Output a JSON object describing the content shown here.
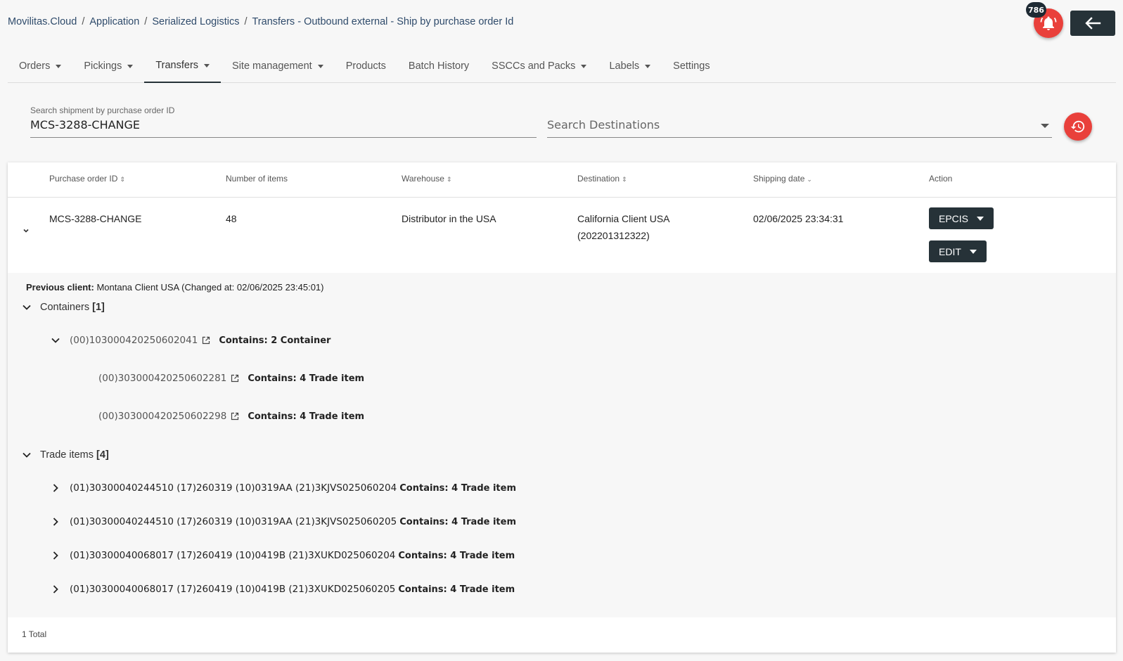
{
  "breadcrumb": [
    {
      "label": "Movilitas.Cloud"
    },
    {
      "label": "Application"
    },
    {
      "label": "Serialized Logistics"
    },
    {
      "label": "Transfers - Outbound external - Ship by purchase order Id"
    }
  ],
  "notifications": {
    "count": "786"
  },
  "nav": {
    "tabs": [
      {
        "label": "Orders",
        "dropdown": true
      },
      {
        "label": "Pickings",
        "dropdown": true
      },
      {
        "label": "Transfers",
        "dropdown": true,
        "active": true
      },
      {
        "label": "Site management",
        "dropdown": true
      },
      {
        "label": "Products",
        "dropdown": false
      },
      {
        "label": "Batch History",
        "dropdown": false
      },
      {
        "label": "SSCCs and Packs",
        "dropdown": true
      },
      {
        "label": "Labels",
        "dropdown": true
      },
      {
        "label": "Settings",
        "dropdown": false
      }
    ]
  },
  "search": {
    "po_label": "Search shipment by purchase order ID",
    "po_value": "MCS-3288-CHANGE",
    "dest_placeholder": "Search Destinations"
  },
  "table": {
    "columns": [
      "Purchase order ID",
      "Number of items",
      "Warehouse",
      "Destination",
      "Shipping date",
      "Action"
    ],
    "row": {
      "po_id": "MCS-3288-CHANGE",
      "items": "48",
      "warehouse": "Distributor in the USA",
      "destination_name": "California Client USA",
      "destination_id": "(202201312322)",
      "shipping_date": "02/06/2025 23:34:31",
      "epcis_label": "EPCIS",
      "edit_label": "EDIT"
    },
    "total": "1 Total"
  },
  "detail": {
    "prev_client_label": "Previous client:",
    "prev_client_value": "Montana Client USA (Changed at: 02/06/2025 23:45:01)",
    "containers": {
      "label": "Containers",
      "count": "[1]",
      "root": {
        "code": "(00)103000420250602041",
        "contains": "Contains: 2 Container"
      },
      "children": [
        {
          "code": "(00)303000420250602281",
          "contains": "Contains: 4 Trade item"
        },
        {
          "code": "(00)303000420250602298",
          "contains": "Contains: 4 Trade item"
        }
      ]
    },
    "trade_items": {
      "label": "Trade items",
      "count": "[4]",
      "items": [
        {
          "code": "(01)30300040244510 (17)260319 (10)0319AA (21)3KJVS025060204",
          "contains": "Contains: 4 Trade item"
        },
        {
          "code": "(01)30300040244510 (17)260319 (10)0319AA (21)3KJVS025060205",
          "contains": "Contains: 4 Trade item"
        },
        {
          "code": "(01)30300040068017 (17)260419 (10)0419B (21)3XUKD025060204",
          "contains": "Contains: 4 Trade item"
        },
        {
          "code": "(01)30300040068017 (17)260419 (10)0419B (21)3XUKD025060205",
          "contains": "Contains: 4 Trade item"
        }
      ]
    }
  },
  "colors": {
    "accent_red": "#e9403b",
    "dark_button": "#263238",
    "badge": "#1e2a33"
  }
}
